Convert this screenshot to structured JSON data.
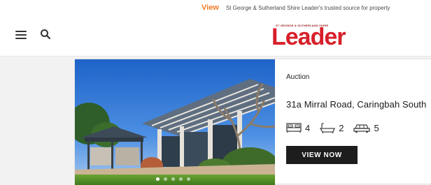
{
  "promo": {
    "link_label": "View",
    "text": "St George & Sutherland Shire Leader's trusted source for property"
  },
  "header": {
    "menu_icon": "hamburger-icon",
    "search_icon": "search-icon",
    "logo": {
      "tagline": "ST GEORGE & SUTHERLAND SHIRE",
      "wordmark": "Leader"
    }
  },
  "listing": {
    "sale_type": "Auction",
    "address": "31a Mirral Road, Caringbah South",
    "beds": "4",
    "baths": "2",
    "cars": "5",
    "cta": "VIEW NOW",
    "carousel_count": 5,
    "carousel_active": 0
  },
  "colors": {
    "accent": "#ef7b2b",
    "brand": "#d8202a",
    "button": "#1d1d1d"
  }
}
